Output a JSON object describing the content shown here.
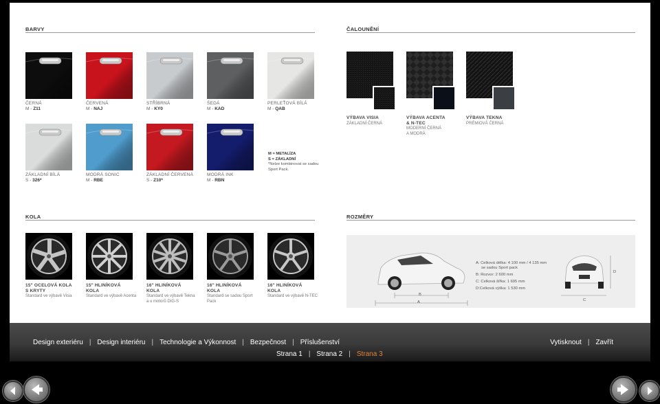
{
  "sections": {
    "colors": "BARVY",
    "upholstery": "ČALOUNĚNÍ",
    "wheels": "KOLA",
    "dimensions": "ROZMĚRY"
  },
  "colors": [
    {
      "name": "ČERNÁ",
      "prefix": "M - ",
      "code": "Z11",
      "swatch": "#0d0d0d"
    },
    {
      "name": "ČERVENÁ",
      "prefix": "M - ",
      "code": "NAJ",
      "swatch": "#c8131d"
    },
    {
      "name": "STŘÍBRNÁ",
      "prefix": "M - ",
      "code": "KY0",
      "swatch": "#c8cbce"
    },
    {
      "name": "ŠEDÁ",
      "prefix": "M - ",
      "code": "KAD",
      "swatch": "#5d5f61"
    },
    {
      "name": "PERLEŤOVÁ BÍLÁ",
      "prefix": "M - ",
      "code": "QAB",
      "swatch": "#e6e6e4"
    },
    {
      "name": "ZÁKLADNÍ BÍLÁ",
      "prefix": "S - ",
      "code": "326*",
      "swatch": "#d9dcdb"
    },
    {
      "name": "MODRÁ SONIC",
      "prefix": "M - ",
      "code": "RBE",
      "swatch": "#4f9ccd"
    },
    {
      "name": "ZÁKLADNÍ ČERVENÁ",
      "prefix": "S - ",
      "code": "Z10*",
      "swatch": "#c41920"
    },
    {
      "name": "MODRÁ INK",
      "prefix": "M - ",
      "code": "RBN",
      "swatch": "#141c6c"
    }
  ],
  "colors_legend": {
    "m": "M = METALÍZA",
    "s": "S = ZÁKLADNÍ",
    "note": "*Nelze kombinovat se sadou Sport Pack."
  },
  "upholstery": [
    {
      "line1": "VÝBAVA VISIA",
      "line2": "",
      "sub1": "ZÁKLADNÍ ČERNÁ",
      "sub2": "",
      "sub3": ""
    },
    {
      "line1": "VÝBAVA ACENTA",
      "line2": "& N-TEC",
      "sub1": "MODERNÍ ČERNÁ",
      "sub2": "A MODRÁ",
      "sub3": ""
    },
    {
      "line1": "VÝBAVA TEKNA",
      "line2": "",
      "sub1": "PRÉMIOVÁ ČERNÁ",
      "sub2": "",
      "sub3": ""
    }
  ],
  "wheels": [
    {
      "l1": "15\" OCELOVÁ KOLA",
      "l2": "S KRYTY",
      "s1": "Standard ve výbavě Visia",
      "s2": ""
    },
    {
      "l1": "15\" HLINÍKOVÁ",
      "l2": "KOLA",
      "s1": "Standard ve výbavě Acenta",
      "s2": ""
    },
    {
      "l1": "16\" HLINÍKOVÁ",
      "l2": "KOLA",
      "s1": "Standard ve výbavě Tekna",
      "s2": "a u motorů DIG-S"
    },
    {
      "l1": "16\" HLINÍKOVÁ",
      "l2": "KOLA",
      "s1": "Standard se sadou Sport",
      "s2": "Pack"
    },
    {
      "l1": "16\" HLINÍKOVÁ",
      "l2": "KOLA",
      "s1": "Standard ve výbavě N-TEC",
      "s2": ""
    }
  ],
  "dimensions": {
    "a_line1": "A: Celková délka: 4 100 mm / 4 135 mm",
    "a_line2": "se sadou Sport pack",
    "b": "B: Rozvor: 2 600 mm",
    "c": "C: Celková šířka: 1 695 mm",
    "d": "D:Celková výška: 1 530 mm",
    "label_a": "A",
    "label_b": "B",
    "label_c": "C",
    "label_d": "D"
  },
  "nav": {
    "links": [
      "Design exteriéru",
      "Design interiéru",
      "Technologie a Výkonnost",
      "Bezpečnost",
      "Příslušenství"
    ],
    "right": [
      "Vytisknout",
      "Zavřít"
    ],
    "pages": [
      "Strana 1",
      "Strana 2",
      "Strana 3"
    ],
    "active_page": "Strana 3",
    "accent": "#e0863a"
  }
}
